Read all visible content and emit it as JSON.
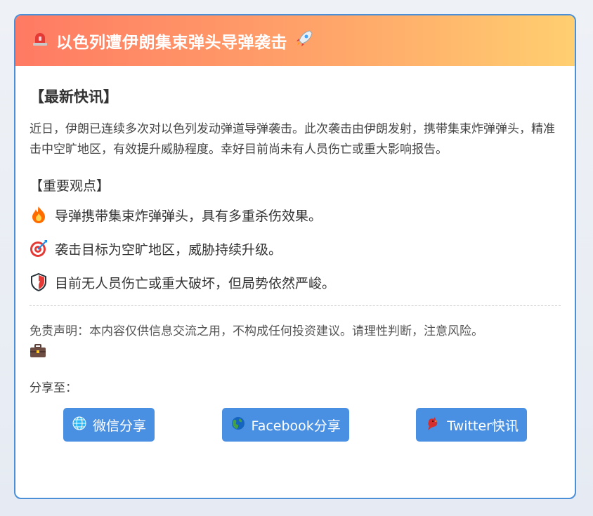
{
  "header": {
    "icon": "siren-icon",
    "title": "以色列遭伊朗集束弹头导弹袭击",
    "trailing_icon": "rocket-icon"
  },
  "news": {
    "heading": "【最新快讯】",
    "body": "近日，伊朗已连续多次对以色列发动弹道导弹袭击。此次袭击由伊朗发射，携带集束炸弹弹头，精准击中空旷地区，有效提升威胁程度。幸好目前尚未有人员伤亡或重大影响报告。"
  },
  "points": {
    "heading": "【重要观点】",
    "items": [
      {
        "icon": "fire-icon",
        "text": "导弹携带集束炸弹弹头，具有多重杀伤效果。"
      },
      {
        "icon": "target-icon",
        "text": "袭击目标为空旷地区，威胁持续升级。"
      },
      {
        "icon": "shield-icon",
        "text": "目前无人员伤亡或重大破坏，但局势依然严峻。"
      }
    ]
  },
  "disclaimer": {
    "text": "免责声明：本内容仅供信息交流之用，不构成任何投资建议。请理性判断，注意风险。",
    "icon": "briefcase-icon"
  },
  "share": {
    "label": "分享至：",
    "buttons": [
      {
        "icon": "globe-icon",
        "label": "微信分享"
      },
      {
        "icon": "earth-icon",
        "label": "Facebook分享"
      },
      {
        "icon": "bird-icon",
        "label": "Twitter快讯"
      }
    ]
  },
  "colors": {
    "header_gradient_start": "#ff7a63",
    "header_gradient_end": "#ffcf70",
    "card_border": "#4a8fd8",
    "button_bg": "#4a90e2"
  }
}
